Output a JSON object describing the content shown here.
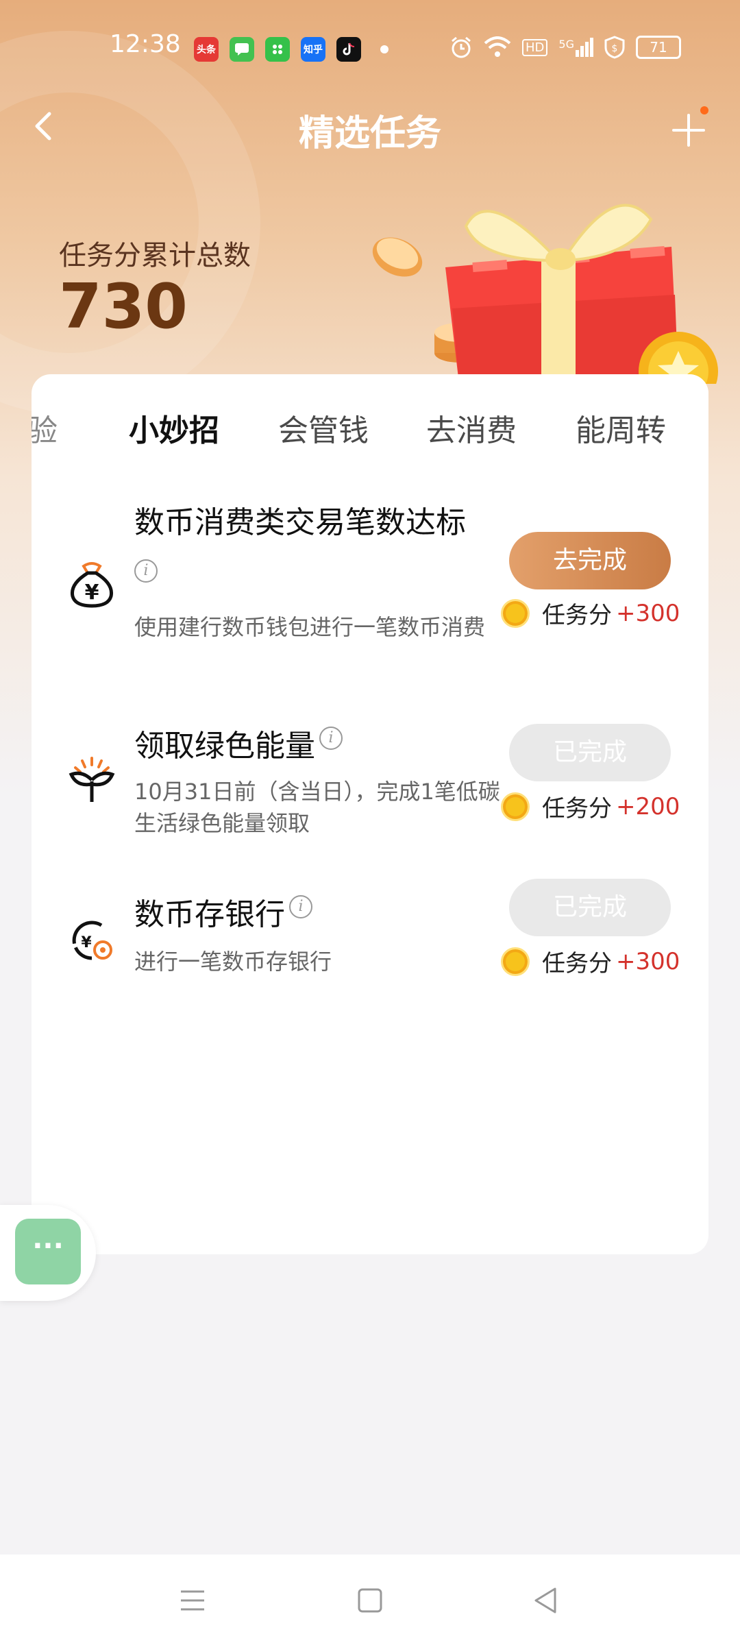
{
  "status_bar": {
    "time": "12:38",
    "apps": [
      {
        "name": "toutiao-app-icon",
        "label": "头条",
        "color": "#e53935"
      },
      {
        "name": "messages-app-icon",
        "label": "",
        "color": "#43c150"
      },
      {
        "name": "market-app-icon",
        "label": "",
        "color": "#35c14a"
      },
      {
        "name": "zhihu-app-icon",
        "label": "知乎",
        "color": "#1772f6"
      },
      {
        "name": "tiktok-app-icon",
        "label": "",
        "color": "#111111"
      }
    ],
    "signal": "5G",
    "hd": "HD",
    "battery": "71"
  },
  "header": {
    "title": "精选任务",
    "back_icon": "chevron-left-icon",
    "add_icon": "plus-icon"
  },
  "summary": {
    "label": "任务分累计总数",
    "value": "730"
  },
  "tabs": [
    {
      "label": "验",
      "state": "cut"
    },
    {
      "label": "小妙招",
      "state": "active"
    },
    {
      "label": "会管钱",
      "state": "normal"
    },
    {
      "label": "去消费",
      "state": "normal"
    },
    {
      "label": "能周转",
      "state": "normal"
    }
  ],
  "tasks": [
    {
      "title": "数币消费类交易笔数达标",
      "description": "使用建行数币钱包进行一笔数币消费",
      "button": "去完成",
      "button_state": "todo",
      "reward_label": "任务分",
      "reward_points": "+300",
      "icon": "money-bag-icon"
    },
    {
      "title": "领取绿色能量",
      "description": "10月31日前（含当日），完成1笔低碳生活绿色能量领取",
      "button": "已完成",
      "button_state": "done",
      "reward_label": "任务分",
      "reward_points": "+200",
      "icon": "sprout-icon"
    },
    {
      "title": "数币存银行",
      "description": "进行一笔数币存银行",
      "button": "已完成",
      "button_state": "done",
      "reward_label": "任务分",
      "reward_points": "+300",
      "icon": "coin-deposit-icon"
    }
  ],
  "floating_button": {
    "label": "···",
    "icon": "more-dots-icon"
  },
  "nav": {
    "menu_icon": "menu-icon",
    "home_icon": "home-square-icon",
    "back_icon": "back-triangle-icon"
  },
  "colors": {
    "accent": "#c97c45",
    "reward": "#d4322c",
    "float": "#8fd4a5"
  }
}
